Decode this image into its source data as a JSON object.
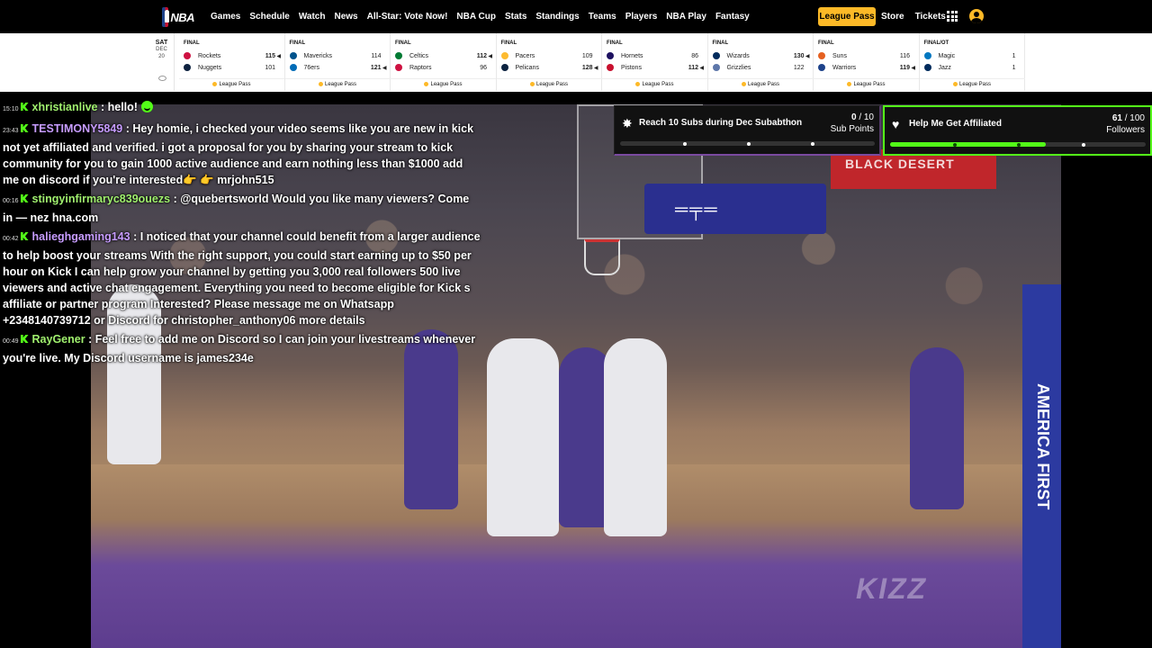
{
  "nav": {
    "logo_text": "NBA",
    "links": [
      "Games",
      "Schedule",
      "Watch",
      "News",
      "All-Star: Vote Now!",
      "NBA Cup",
      "Stats",
      "Standings",
      "Teams",
      "Players",
      "NBA Play",
      "Fantasy"
    ],
    "league_pass_label": "League Pass",
    "store_label": "Store",
    "tickets_label": "Tickets"
  },
  "scoreboard": {
    "date": {
      "dow": "SAT",
      "month": "DEC",
      "day": "20"
    },
    "games": [
      {
        "status": "FINAL",
        "teams": [
          {
            "name": "Rockets",
            "score": "115",
            "winner": true,
            "color": "#ce1141"
          },
          {
            "name": "Nuggets",
            "score": "101",
            "winner": false,
            "color": "#0e2240"
          }
        ]
      },
      {
        "status": "FINAL",
        "teams": [
          {
            "name": "Mavericks",
            "score": "114",
            "winner": false,
            "color": "#00538c"
          },
          {
            "name": "76ers",
            "score": "121",
            "winner": true,
            "color": "#006bb6"
          }
        ]
      },
      {
        "status": "FINAL",
        "teams": [
          {
            "name": "Celtics",
            "score": "112",
            "winner": true,
            "color": "#007a33"
          },
          {
            "name": "Raptors",
            "score": "96",
            "winner": false,
            "color": "#ce1141"
          }
        ]
      },
      {
        "status": "FINAL",
        "teams": [
          {
            "name": "Pacers",
            "score": "109",
            "winner": false,
            "color": "#fdbb30"
          },
          {
            "name": "Pelicans",
            "score": "128",
            "winner": true,
            "color": "#0c2340"
          }
        ]
      },
      {
        "status": "FINAL",
        "teams": [
          {
            "name": "Hornets",
            "score": "86",
            "winner": false,
            "color": "#1d1160"
          },
          {
            "name": "Pistons",
            "score": "112",
            "winner": true,
            "color": "#c8102e"
          }
        ]
      },
      {
        "status": "FINAL",
        "teams": [
          {
            "name": "Wizards",
            "score": "130",
            "winner": true,
            "color": "#002b5c"
          },
          {
            "name": "Grizzlies",
            "score": "122",
            "winner": false,
            "color": "#5d76a9"
          }
        ]
      },
      {
        "status": "FINAL",
        "teams": [
          {
            "name": "Suns",
            "score": "116",
            "winner": false,
            "color": "#e56020"
          },
          {
            "name": "Warriors",
            "score": "119",
            "winner": true,
            "color": "#1d428a"
          }
        ]
      },
      {
        "status": "FINAL/OT",
        "teams": [
          {
            "name": "Magic",
            "score": "1",
            "winner": false,
            "color": "#0077c0"
          },
          {
            "name": "Jazz",
            "score": "1",
            "winner": false,
            "color": "#002b5c"
          }
        ]
      }
    ],
    "league_pass_label": "League Pass"
  },
  "chat": {
    "messages": [
      {
        "time": "15:10",
        "user": "xhristianlive",
        "user_color": "#a0f06e",
        "text": ": hello!"
      },
      {
        "time": "23:43",
        "user": "TESTIMONY5849",
        "user_color": "#c79cff",
        "text": ": Hey homie, i checked your video seems like you are new in kick not yet affiliated and verified. i got a proposal for you by sharing your stream to kick community for you to gain 1000 active audience and earn nothing less than $1000 add me on discord if you're interested👉 👉 mrjohn515"
      },
      {
        "time": "00:16",
        "user": "stingyinfirmaryc839ouezs",
        "user_color": "#a0f06e",
        "text": ": @quebertsworld Would you like many viewers? Come in — nez hna.com"
      },
      {
        "time": "00:42",
        "user": "halieghgaming143",
        "user_color": "#c79cff",
        "text": ": I noticed that your channel could benefit from a larger audience to help boost your streams With the right support, you could start earning up to $50 per hour on Kick I can help grow your channel by getting you 3,000 real followers 500 live viewers and active chat engagement. Everything you need to become eligible for Kick s affiliate or partner program Interested? Please message me on Whatsapp +2348140739712 or Discord for christopher_anthony06 more details"
      },
      {
        "time": "00:49",
        "user": "RayGener",
        "user_color": "#a0f06e",
        "text": ": Feel free to add me on Discord so I can join your livestreams whenever you're live. My Discord username is james234e"
      }
    ]
  },
  "goals": [
    {
      "title": "Reach 10 Subs during Dec Subabthon",
      "current": "0",
      "target": "/ 10",
      "unit": "Sub Points",
      "progress": 0.0
    },
    {
      "title": "Help Me Get Affiliated",
      "current": "61",
      "target": "/ 100",
      "unit": "Followers",
      "progress": 0.61
    }
  ],
  "video": {
    "banner_text": "BLACK DESERT",
    "stanchion_text": "AMERICA FIRST",
    "watermark": "KIZZ"
  }
}
